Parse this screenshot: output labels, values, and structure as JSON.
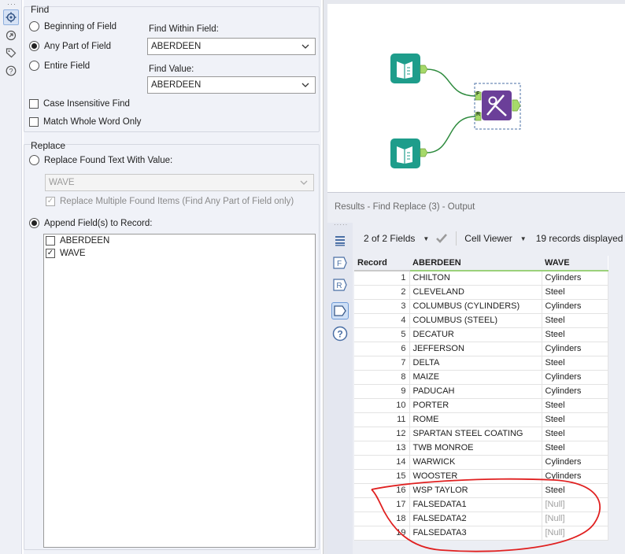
{
  "config": {
    "find_title": "Find",
    "find_options": [
      {
        "label": "Beginning of Field",
        "selected": false
      },
      {
        "label": "Any Part of Field",
        "selected": true
      },
      {
        "label": "Entire Field",
        "selected": false
      }
    ],
    "find_within_label": "Find Within Field:",
    "find_within_value": "ABERDEEN",
    "find_value_label": "Find Value:",
    "find_value_value": "ABERDEEN",
    "case_insensitive": {
      "label": "Case Insensitive Find",
      "checked": false
    },
    "match_whole_word": {
      "label": "Match Whole Word Only",
      "checked": false
    },
    "replace_title": "Replace",
    "replace_found_label": "Replace Found Text With Value:",
    "replace_found_selected": false,
    "replace_value": "WAVE",
    "replace_multiple": {
      "label": "Replace Multiple Found Items (Find Any Part of Field only)",
      "checked": true
    },
    "append_label": "Append Field(s) to Record:",
    "append_selected": true,
    "append_fields": [
      {
        "label": "ABERDEEN",
        "checked": false
      },
      {
        "label": "WAVE",
        "checked": true
      }
    ]
  },
  "canvas": {
    "anchor_f": "F",
    "anchor_r": "R"
  },
  "results": {
    "title": "Results - Find Replace (3) - Output",
    "fields_label": "2 of 2 Fields",
    "viewer_label": "Cell Viewer",
    "records_label": "19 records displayed",
    "columns": [
      "Record",
      "ABERDEEN",
      "WAVE"
    ],
    "rows": [
      [
        "1",
        "CHILTON",
        "Cylinders"
      ],
      [
        "2",
        "CLEVELAND",
        "Steel"
      ],
      [
        "3",
        "COLUMBUS (CYLINDERS)",
        "Cylinders"
      ],
      [
        "4",
        "COLUMBUS (STEEL)",
        "Steel"
      ],
      [
        "5",
        "DECATUR",
        "Steel"
      ],
      [
        "6",
        "JEFFERSON",
        "Cylinders"
      ],
      [
        "7",
        "DELTA",
        "Steel"
      ],
      [
        "8",
        "MAIZE",
        "Cylinders"
      ],
      [
        "9",
        "PADUCAH",
        "Cylinders"
      ],
      [
        "10",
        "PORTER",
        "Steel"
      ],
      [
        "11",
        "ROME",
        "Steel"
      ],
      [
        "12",
        "SPARTAN STEEL COATING",
        "Steel"
      ],
      [
        "13",
        "TWB MONROE",
        "Steel"
      ],
      [
        "14",
        "WARWICK",
        "Cylinders"
      ],
      [
        "15",
        "WOOSTER",
        "Cylinders"
      ],
      [
        "16",
        "WSP TAYLOR",
        "Steel"
      ],
      [
        "17",
        "FALSEDATA1",
        "[Null]"
      ],
      [
        "18",
        "FALSEDATA2",
        "[Null]"
      ],
      [
        "19",
        "FALSEDATA3",
        "[Null]"
      ]
    ],
    "side_icons": [
      "list-icon",
      "f-anchor-icon",
      "r-anchor-icon",
      "output-anchor-icon",
      "help-icon"
    ]
  },
  "colors": {
    "input_tool": "#1e9d8b",
    "find_replace_tool": "#6b3f99",
    "connector": "#2e8b3e",
    "anchor": "#a6d96a",
    "annotation": "#e02020"
  }
}
